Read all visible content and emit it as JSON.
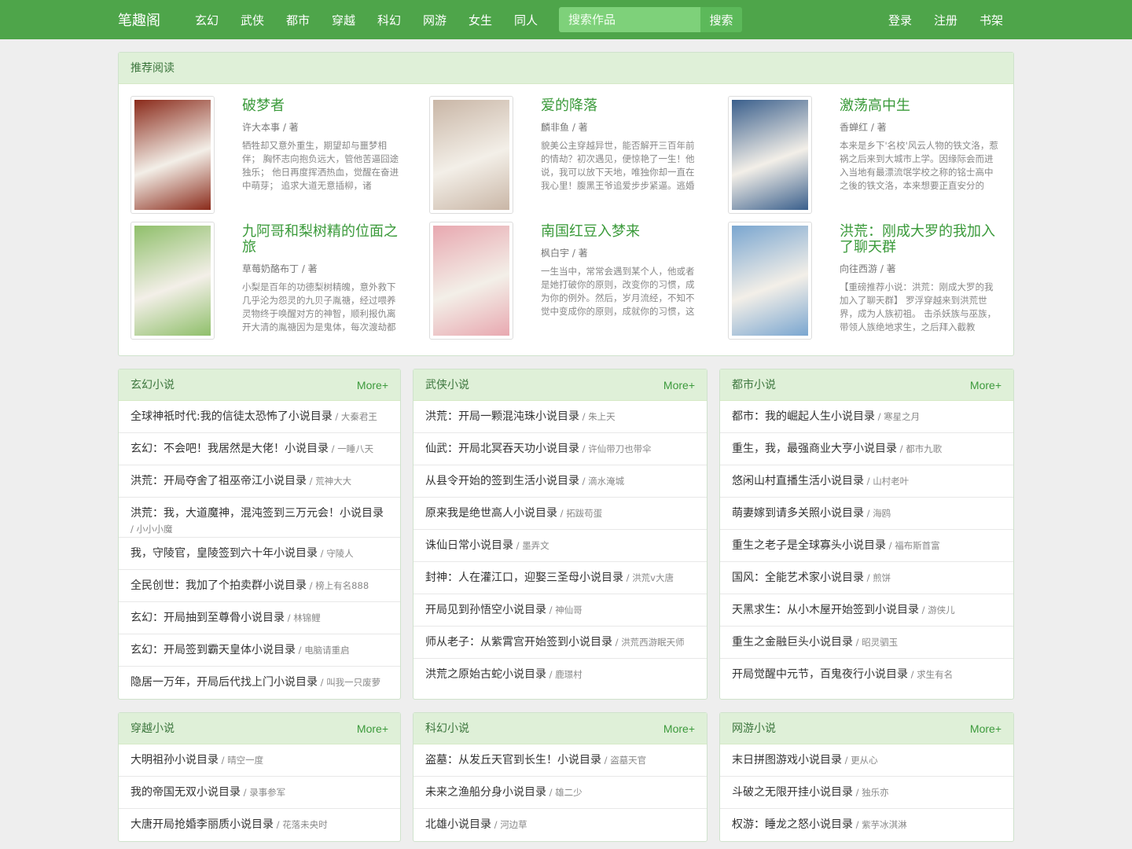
{
  "nav": {
    "brand": "笔趣阁",
    "links": [
      "玄幻",
      "武侠",
      "都市",
      "穿越",
      "科幻",
      "网游",
      "女生",
      "同人"
    ],
    "search_placeholder": "搜索作品",
    "search_button": "搜索",
    "right": [
      "登录",
      "注册",
      "书架"
    ]
  },
  "recommended": {
    "title": "推荐阅读",
    "books": [
      {
        "title": "破梦者",
        "author": "许大本事 / 著",
        "desc": "牺牲却又意外重生，期望却与噩梦相伴； 胸怀志向抱负远大，管他苦逼囧途独乐； 他日再度挥洒热血，觉醒在奋进中萌芽； 追求大道无意插柳，诸",
        "cover_color": "#8a2a1a"
      },
      {
        "title": "爱的降落",
        "author": "麟非鱼 / 著",
        "desc": "貌美公主穿越异世，能否解开三百年前的情劫？初次遇见，便惊艳了一生！他说，我可以放下天地，唯独你却一直在我心里！腹黑王爷追爱步步紧逼。逃婚",
        "cover_color": "#c9b6a6"
      },
      {
        "title": "激荡高中生",
        "author": "香蝉红 / 著",
        "desc": "本来是乡下'名校'风云人物的铁文洛，惹祸之后来到大城市上学。因缘际会而进入当地有最漂流氓学校之称的铭士高中之後的铁文洛，本来想要正直安分的",
        "cover_color": "#3a5f8c"
      },
      {
        "title": "九阿哥和梨树精的位面之旅",
        "author": "草莓奶酪布丁 / 著",
        "desc": "小梨是百年的功德梨树精魄，意外救下几乎沦为怨灵的九贝子胤禟，经过喂养灵物终于唤醒对方的神智，顺利报仇离开大清的胤禟因为是鬼体，每次渡劫都",
        "cover_color": "#8fbf6a"
      },
      {
        "title": "南国红豆入梦来",
        "author": "枫白宇 / 著",
        "desc": "一生当中，常常会遇到某个人，他或者是她打破你的原则，改变你的习惯，成为你的例外。然后，岁月流经，不知不觉中变成你的原则，成就你的习惯，这",
        "cover_color": "#e8a8b0"
      },
      {
        "title": "洪荒：刚成大罗的我加入了聊天群",
        "author": "向往西游 / 著",
        "desc": "【重磅推荐小说：洪荒：刚成大罗的我加入了聊天群】 罗浮穿越来到洪荒世界，成为人族初祖。 击杀妖族与巫族，带领人族绝地求生，之后拜入截教",
        "cover_color": "#7aa6d0"
      }
    ]
  },
  "categories": [
    {
      "title": "玄幻小说",
      "more": "More+",
      "items": [
        {
          "title": "全球神祇时代:我的信徒太恐怖了小说目录",
          "author": "大秦君王"
        },
        {
          "title": "玄幻：不会吧！我居然是大佬！小说目录",
          "author": "一睡八天"
        },
        {
          "title": "洪荒：开局夺舍了祖巫帝江小说目录",
          "author": "荒神大大"
        },
        {
          "title": "洪荒：我，大道魔神，混沌签到三万元会！小说目录",
          "author": "小小小魔"
        },
        {
          "title": "我，守陵官，皇陵签到六十年小说目录",
          "author": "守陵人"
        },
        {
          "title": "全民创世：我加了个拍卖群小说目录",
          "author": "榜上有名888"
        },
        {
          "title": "玄幻：开局抽到至尊骨小说目录",
          "author": "林锦鲤"
        },
        {
          "title": "玄幻：开局签到霸天皇体小说目录",
          "author": "电脑请重启"
        },
        {
          "title": "隐居一万年，开局后代找上门小说目录",
          "author": "叫我一只废萝"
        }
      ]
    },
    {
      "title": "武侠小说",
      "more": "More+",
      "items": [
        {
          "title": "洪荒：开局一颗混沌珠小说目录",
          "author": "朱上天"
        },
        {
          "title": "仙武：开局北冥吞天功小说目录",
          "author": "许仙带刀也带伞"
        },
        {
          "title": "从县令开始的签到生活小说目录",
          "author": "滴水淹城"
        },
        {
          "title": "原来我是绝世高人小说目录",
          "author": "拓跋苟蛋"
        },
        {
          "title": "诛仙日常小说目录",
          "author": "墨弄文"
        },
        {
          "title": "封神：人在灌江口，迎娶三圣母小说目录",
          "author": "洪荒v大唐"
        },
        {
          "title": "开局见到孙悟空小说目录",
          "author": "神仙哥"
        },
        {
          "title": "师从老子：从紫霄宫开始签到小说目录",
          "author": "洪荒西游眠天师"
        },
        {
          "title": "洪荒之原始古蛇小说目录",
          "author": "鹿璟村"
        }
      ]
    },
    {
      "title": "都市小说",
      "more": "More+",
      "items": [
        {
          "title": "都市：我的崛起人生小说目录",
          "author": "寒星之月"
        },
        {
          "title": "重生，我，最强商业大亨小说目录",
          "author": "都市九歌"
        },
        {
          "title": "悠闲山村直播生活小说目录",
          "author": "山村老叶"
        },
        {
          "title": "萌妻嫁到请多关照小说目录",
          "author": "海鸥"
        },
        {
          "title": "重生之老子是全球寡头小说目录",
          "author": "福布斯首富"
        },
        {
          "title": "国风：全能艺术家小说目录",
          "author": "煎饼"
        },
        {
          "title": "天黑求生：从小木屋开始签到小说目录",
          "author": "游侠儿"
        },
        {
          "title": "重生之金融巨头小说目录",
          "author": "昭灵驷玉"
        },
        {
          "title": "开局觉醒中元节，百鬼夜行小说目录",
          "author": "求生有名"
        }
      ]
    },
    {
      "title": "穿越小说",
      "more": "More+",
      "items": [
        {
          "title": "大明祖孙小说目录",
          "author": "晴空一度"
        },
        {
          "title": "我的帝国无双小说目录",
          "author": "录事参军"
        },
        {
          "title": "大唐开局抢婚李丽质小说目录",
          "author": "花落未央时"
        }
      ]
    },
    {
      "title": "科幻小说",
      "more": "More+",
      "items": [
        {
          "title": "盗墓：从发丘天官到长生！小说目录",
          "author": "盗墓天官"
        },
        {
          "title": "未来之渔船分身小说目录",
          "author": "雄二少"
        },
        {
          "title": "北雄小说目录",
          "author": "河边草"
        }
      ]
    },
    {
      "title": "网游小说",
      "more": "More+",
      "items": [
        {
          "title": "末日拼图游戏小说目录",
          "author": "更从心"
        },
        {
          "title": "斗破之无限开挂小说目录",
          "author": "独乐亦"
        },
        {
          "title": "权游：睡龙之怒小说目录",
          "author": "紫芋冰淇淋"
        }
      ]
    }
  ]
}
